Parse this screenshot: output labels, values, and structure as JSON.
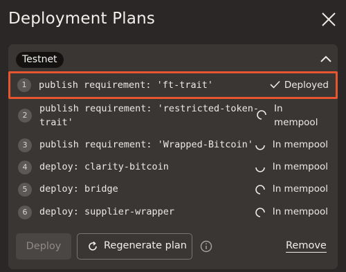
{
  "header": {
    "title": "Deployment Plans"
  },
  "network": {
    "badge": "Testnet"
  },
  "steps": [
    {
      "index": "1",
      "label": "publish requirement: 'ft-trait'",
      "status": "Deployed",
      "state": "done"
    },
    {
      "index": "2",
      "label_line1": "publish requirement: 'restricted-token-",
      "label_line2": "trait'",
      "status_line1": "In",
      "status_line2": "mempool",
      "state": "pending"
    },
    {
      "index": "3",
      "label": "publish requirement: 'Wrapped-Bitcoin'",
      "status": "In mempool",
      "state": "pending"
    },
    {
      "index": "4",
      "label": "deploy: clarity-bitcoin",
      "status": "In mempool",
      "state": "pending"
    },
    {
      "index": "5",
      "label": "deploy: bridge",
      "status": "In mempool",
      "state": "pending"
    },
    {
      "index": "6",
      "label": "deploy: supplier-wrapper",
      "status": "In mempool",
      "state": "pending"
    }
  ],
  "footer": {
    "deploy_label": "Deploy",
    "regenerate_label": "Regenerate plan",
    "remove_label": "Remove"
  },
  "colors": {
    "highlight": "#e8562f",
    "background": "#2a2726",
    "panel": "#3a3634"
  }
}
